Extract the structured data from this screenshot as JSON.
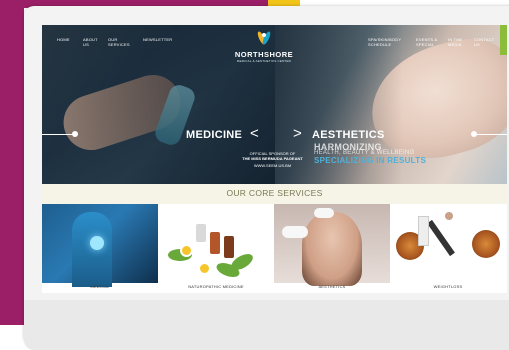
{
  "nav": {
    "left": [
      "HOME",
      "ABOUT US",
      "OUR SERVICES",
      "NEWSLETTER"
    ],
    "right": [
      "SPA/SKIN/BODY SCHEDULE",
      "EVENTS & SPECIAL",
      "IN THE MEDIA",
      "CONTACT US"
    ]
  },
  "logo": {
    "name": "NORTHSHORE",
    "tagline": "MEDICAL & AESTHETICS CENTER"
  },
  "hero": {
    "left_title": "MEDICINE",
    "right_title": "AESTHETICS",
    "prev": "<",
    "next": ">",
    "sponsor_line1": "OFFICIAL SPONSOR OF",
    "sponsor_line2": "THE MISS BERMUDA PAGEANT",
    "sponsor_url": "WWW.SEEM.US.BM",
    "tag1": "HARMONIZING",
    "tag2": "HEALTH, BEAUTY & WELLBEING",
    "tag3": "SPECIALIZING IN RESULTS"
  },
  "services": {
    "title": "OUR CORE SERVICES",
    "items": [
      {
        "label": "MEDICAL"
      },
      {
        "label": "NATUROPATHIC MEDICINE"
      },
      {
        "label": "AESTHETICS"
      },
      {
        "label": "WEIGHTLOSS"
      }
    ]
  },
  "colors": {
    "frame_magenta": "#9a1f66",
    "accent_yellow": "#f2c418",
    "accent_green": "#8bbd3a",
    "brand_blue": "#4fb1d8"
  }
}
